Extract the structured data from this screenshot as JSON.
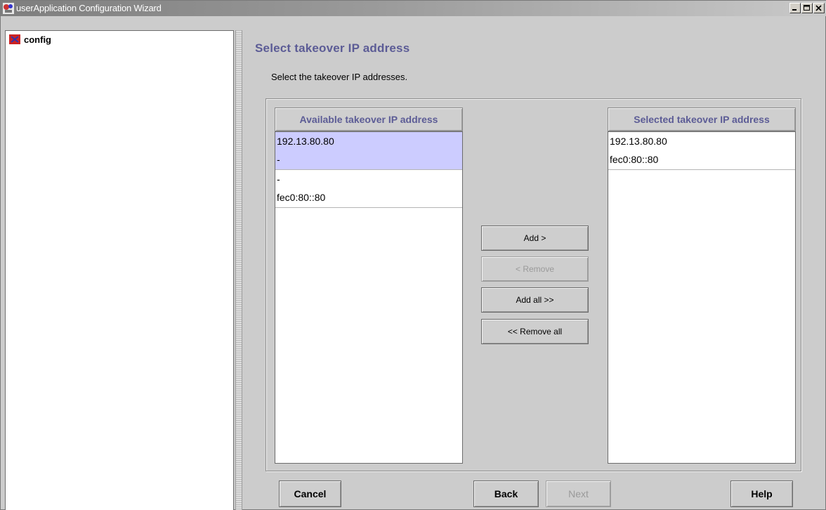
{
  "window": {
    "title": "userApplication Configuration Wizard"
  },
  "tree": {
    "root_label": "config"
  },
  "page": {
    "title": "Select takeover IP address",
    "instruction": "Select the takeover IP addresses."
  },
  "available_list": {
    "header": "Available takeover IP address",
    "rows": [
      {
        "lines": [
          "192.13.80.80",
          "-"
        ],
        "selected": true
      },
      {
        "lines": [
          "-",
          "fec0:80::80"
        ],
        "selected": false
      }
    ]
  },
  "selected_list": {
    "header": "Selected takeover IP address",
    "rows": [
      {
        "lines": [
          "192.13.80.80",
          "fec0:80::80"
        ],
        "selected": false
      }
    ]
  },
  "transfer_buttons": {
    "add": "Add >",
    "remove": "< Remove",
    "add_all": "Add all >>",
    "remove_all": "<< Remove all"
  },
  "footer_buttons": {
    "cancel": "Cancel",
    "back": "Back",
    "next": "Next",
    "help": "Help"
  },
  "colors": {
    "accent_text": "#5c5c96",
    "selection": "#ccccff"
  }
}
